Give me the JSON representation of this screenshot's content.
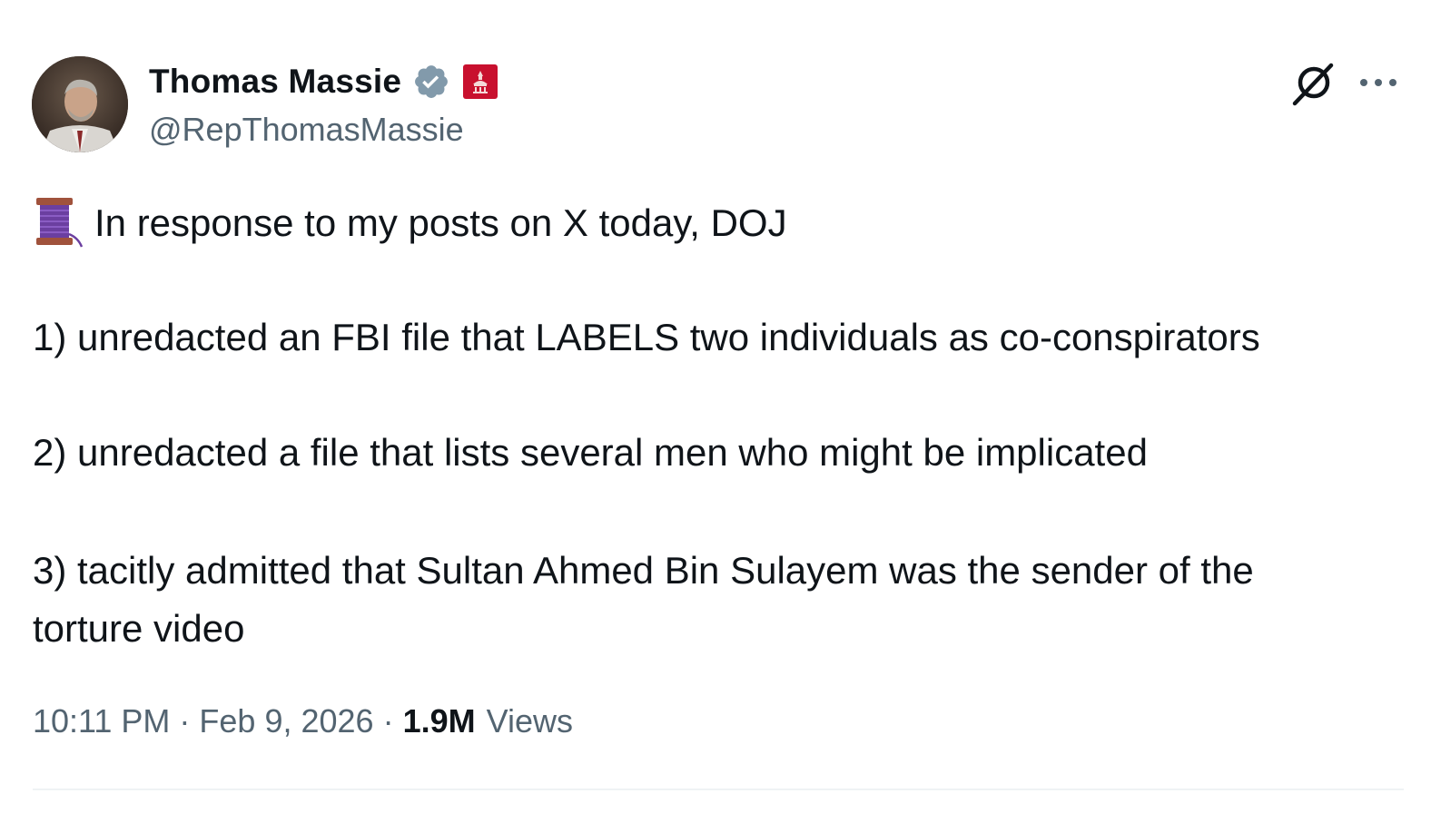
{
  "author": {
    "display_name": "Thomas Massie",
    "handle": "@RepThomasMassie",
    "verified_badge_color": "#829aab",
    "affiliation_badge_color": "#c8102e"
  },
  "tweet": {
    "line1": "In response to my posts on X today, DOJ",
    "point1": "1) unredacted an FBI file that LABELS two individuals as co-conspirators",
    "point2": "2) unredacted a file that lists several men who might be implicated",
    "point3_line1": "3) tacitly admitted that Sultan Ahmed Bin Sulayem was the sender of the",
    "point3_line2": "torture video"
  },
  "meta": {
    "time": "10:11 PM",
    "separator": "·",
    "date": "Feb 9, 2026",
    "views_count": "1.9M",
    "views_label": "Views"
  },
  "icons": {
    "thread": "spool-of-thread-emoji",
    "grok": "grok-icon",
    "more": "more-options-icon"
  }
}
